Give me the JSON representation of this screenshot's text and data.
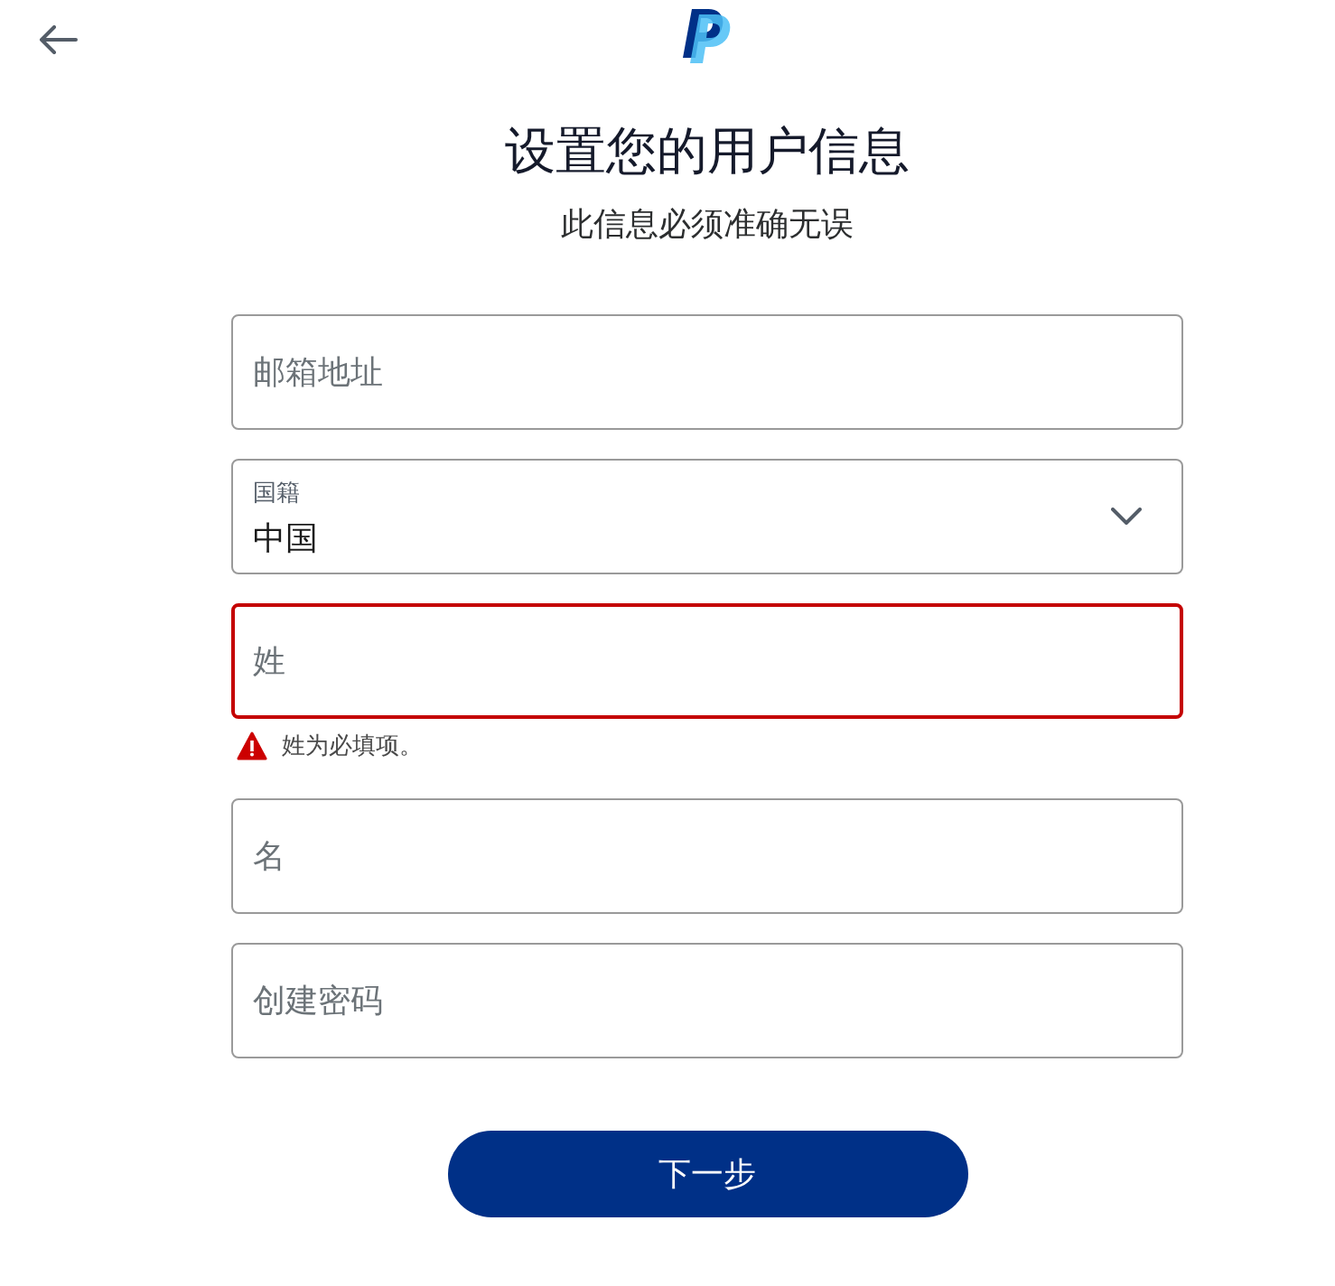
{
  "header": {
    "title": "设置您的用户信息",
    "subtitle": "此信息必须准确无误"
  },
  "fields": [
    {
      "kind": "text",
      "placeholder": "邮箱地址",
      "invalid": false
    },
    {
      "kind": "select",
      "label": "国籍",
      "value": "中国",
      "invalid": false
    },
    {
      "kind": "text",
      "placeholder": "姓",
      "invalid": true,
      "error": "姓为必填项。"
    },
    {
      "kind": "text",
      "placeholder": "名",
      "invalid": false
    },
    {
      "kind": "password",
      "placeholder": "创建密码",
      "invalid": false
    }
  ],
  "button": {
    "label": "下一步"
  }
}
